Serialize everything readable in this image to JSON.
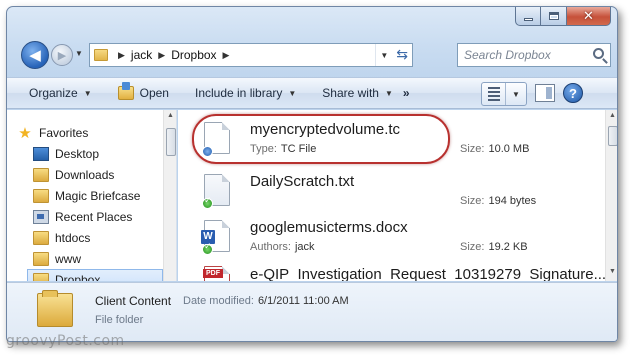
{
  "window": {
    "caption": {
      "minimize": "",
      "maximize": "",
      "close": "✕"
    }
  },
  "address_bar": {
    "breadcrumbs": [
      "jack",
      "Dropbox"
    ],
    "search_placeholder": "Search Dropbox"
  },
  "toolbar": {
    "organize_label": "Organize",
    "open_label": "Open",
    "include_label": "Include in library",
    "share_label": "Share with",
    "more_label": "»",
    "help_label": "?"
  },
  "navigation": {
    "items": [
      {
        "label": "Favorites",
        "icon": "star-icon"
      },
      {
        "label": "Desktop",
        "icon": "desktop-icon"
      },
      {
        "label": "Downloads",
        "icon": "folder-icon"
      },
      {
        "label": "Magic Briefcase",
        "icon": "folder-icon"
      },
      {
        "label": "Recent Places",
        "icon": "recent-places-icon"
      },
      {
        "label": "htdocs",
        "icon": "folder-icon"
      },
      {
        "label": "www",
        "icon": "folder-icon"
      },
      {
        "label": "Dropbox",
        "icon": "folder-icon",
        "selected": true
      }
    ]
  },
  "files": [
    {
      "name": "myencryptedvolume.tc",
      "meta_label": "Type:",
      "meta_value": "TC File",
      "size_label": "Size:",
      "size_value": "10.0 MB",
      "icon": "tc-file-icon",
      "badge": "sync",
      "highlighted": true
    },
    {
      "name": "DailyScratch.txt",
      "meta_label": "",
      "meta_value": "",
      "size_label": "Size:",
      "size_value": "194 bytes",
      "icon": "text-file-icon",
      "badge": "ok"
    },
    {
      "name": "googlemusicterms.docx",
      "meta_label": "Authors:",
      "meta_value": "jack",
      "size_label": "Size:",
      "size_value": "19.2 KB",
      "icon": "word-doc-icon",
      "badge": "ok"
    },
    {
      "name": "e-QIP_Investigation_Request_10319279_Signature...",
      "meta_label": "",
      "meta_value": "",
      "size_label": "",
      "size_value": "",
      "icon": "pdf-file-icon",
      "badge": ""
    }
  ],
  "details": {
    "name": "Client Content",
    "date_label": "Date modified:",
    "date_value": "6/1/2011 11:00 AM",
    "type": "File folder"
  },
  "watermark": "groovyPost.com",
  "colors": {
    "highlight_ring": "#b8312f",
    "selection": "#cde2fb",
    "frame": "#c9dcf1"
  }
}
